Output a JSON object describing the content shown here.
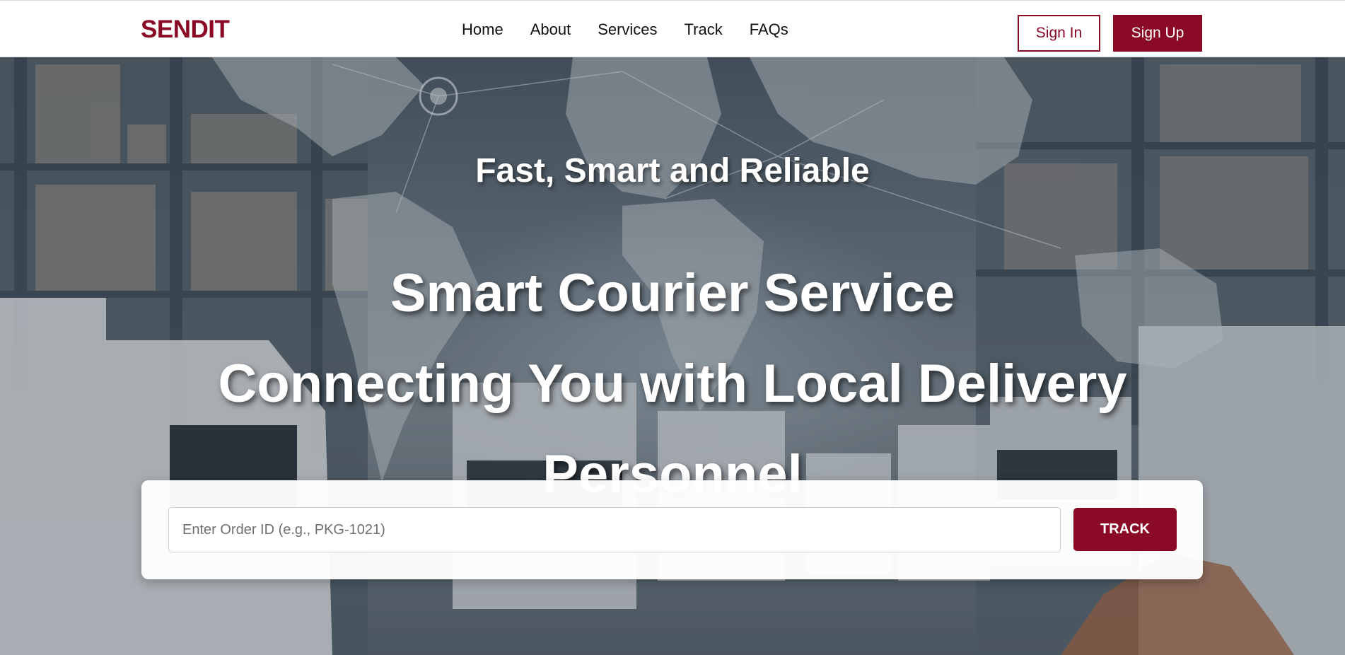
{
  "brand": {
    "name": "SENDIT",
    "color": "#8a0a26"
  },
  "nav": {
    "links": [
      "Home",
      "About",
      "Services",
      "Track",
      "FAQs"
    ],
    "sign_in": "Sign In",
    "sign_up": "Sign Up"
  },
  "hero": {
    "tagline": "Fast, Smart and Reliable",
    "headline_lines": [
      "Smart Courier Service",
      "Connecting You with Local Delivery",
      "Personnel"
    ],
    "background": "warehouse-world-map-trucks-image"
  },
  "tracking": {
    "placeholder": "Enter Order ID (e.g., PKG-1021)",
    "value": "",
    "button_label": "TRACK"
  }
}
